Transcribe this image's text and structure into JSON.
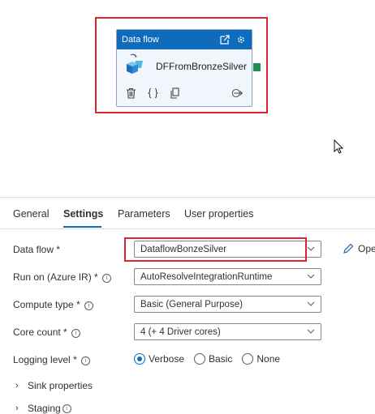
{
  "canvas": {
    "activity": {
      "type_label": "Data flow",
      "name": "DFFromBronzeSilver",
      "icons": [
        "external-link-icon",
        "settings-cog-icon",
        "dataflow-icon",
        "delete-icon",
        "code-braces-icon",
        "copy-icon",
        "arrow-out-icon"
      ]
    },
    "highlight_color": "#e0222e",
    "success_port_color": "#1f8f4f"
  },
  "tabs": [
    {
      "label": "General",
      "active": false
    },
    {
      "label": "Settings",
      "active": true
    },
    {
      "label": "Parameters",
      "active": false
    },
    {
      "label": "User properties",
      "active": false
    }
  ],
  "settings": {
    "data_flow": {
      "label": "Data flow",
      "required": "*",
      "value": "DataflowBonzeSilver",
      "open_label": "Ope"
    },
    "run_on": {
      "label": "Run on (Azure IR)",
      "required": "*",
      "value": "AutoResolveIntegrationRuntime"
    },
    "compute_type": {
      "label": "Compute type",
      "required": "*",
      "value": "Basic (General Purpose)"
    },
    "core_count": {
      "label": "Core count",
      "required": "*",
      "value": "4 (+ 4 Driver cores)"
    },
    "logging_level": {
      "label": "Logging level",
      "required": "*",
      "options": [
        {
          "label": "Verbose",
          "checked": true
        },
        {
          "label": "Basic",
          "checked": false
        },
        {
          "label": "None",
          "checked": false
        }
      ]
    },
    "sink_properties": {
      "label": "Sink properties"
    },
    "staging": {
      "label": "Staging"
    }
  },
  "accent_color": "#0f6cbd"
}
